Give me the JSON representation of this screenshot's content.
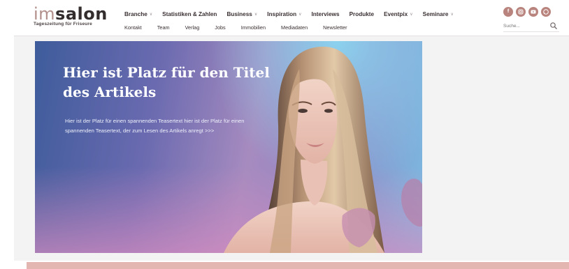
{
  "logo": {
    "prefix": "im",
    "brand": "salon",
    "tagline": "Tageszeitung für Friseure"
  },
  "nav_primary": [
    {
      "label": "Branche",
      "has_caret": true
    },
    {
      "label": "Statistiken & Zahlen",
      "has_caret": false
    },
    {
      "label": "Business",
      "has_caret": true
    },
    {
      "label": "Inspiration",
      "has_caret": true
    },
    {
      "label": "Interviews",
      "has_caret": false
    },
    {
      "label": "Produkte",
      "has_caret": false
    },
    {
      "label": "Eventpix",
      "has_caret": true
    },
    {
      "label": "Seminare",
      "has_caret": true
    }
  ],
  "nav_secondary": [
    "Kontakt",
    "Team",
    "Verlag",
    "Jobs",
    "Immobilien",
    "Mediadaten",
    "Newsletter"
  ],
  "social": [
    "facebook-icon",
    "instagram-icon",
    "youtube-icon",
    "whatsapp-icon"
  ],
  "search": {
    "placeholder": "Suche..."
  },
  "hero": {
    "title": "Hier ist Platz für den Titel des Artikels",
    "teaser": "Hier ist der Platz für einen spannenden Teasertext hier ist der Platz für einen spannenden Teasertext, der zum Lesen des Artikels anregt >>>"
  },
  "colors": {
    "brand_rose": "#b28f8a",
    "social_rose": "#b9847d",
    "bottom_band": "#e3b6b1",
    "nav_text": "#3a2f31"
  }
}
